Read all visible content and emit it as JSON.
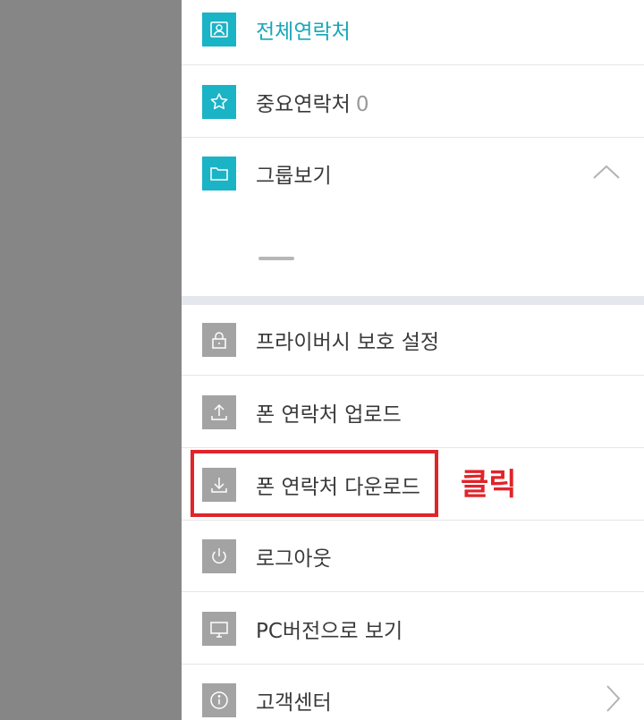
{
  "menu": {
    "top_items": [
      {
        "label": "전체연락처",
        "icon": "contacts-icon"
      },
      {
        "label": "중요연락처",
        "count": "0",
        "icon": "star-icon"
      },
      {
        "label": "그룹보기",
        "icon": "folder-icon"
      }
    ],
    "settings_items": [
      {
        "label": "프라이버시 보호 설정",
        "icon": "lock-icon"
      },
      {
        "label": "폰 연락처 업로드",
        "icon": "upload-icon"
      },
      {
        "label": "폰 연락처 다운로드",
        "icon": "download-icon"
      },
      {
        "label": "로그아웃",
        "icon": "power-icon"
      },
      {
        "label": "PC버전으로 보기",
        "icon": "monitor-icon"
      },
      {
        "label": "고객센터",
        "icon": "info-icon"
      }
    ]
  },
  "annotation": {
    "callout": "클릭"
  },
  "colors": {
    "accent": "#1bb3c6",
    "highlight": "#e0242a",
    "icon_gray": "#a3a3a3",
    "overlay": "#868686"
  }
}
